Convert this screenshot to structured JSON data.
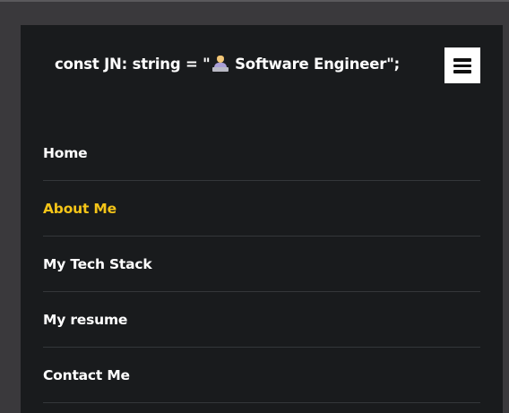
{
  "brand": {
    "prefix": "const JN: string = \"",
    "emoji_icon": "person-at-laptop-icon",
    "suffix": " Software Engineer\";"
  },
  "menu_button": {
    "icon": "hamburger-icon"
  },
  "nav": {
    "items": [
      {
        "label": "Home",
        "active": false
      },
      {
        "label": "About Me",
        "active": true
      },
      {
        "label": "My Tech Stack",
        "active": false
      },
      {
        "label": "My resume",
        "active": false
      },
      {
        "label": "Contact Me",
        "active": false
      }
    ]
  },
  "colors": {
    "page_background": "#191b1d",
    "outer_background": "#3a393c",
    "text": "#ffffff",
    "active": "#f5c518",
    "divider": "#34373a"
  }
}
